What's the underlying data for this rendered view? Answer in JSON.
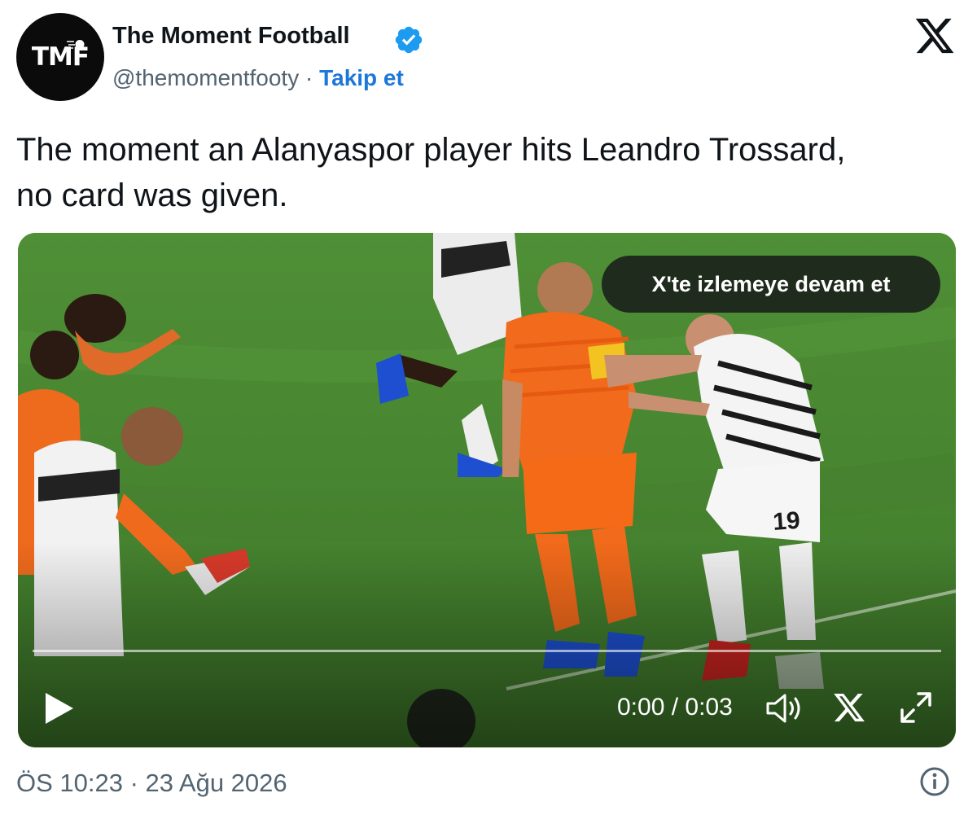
{
  "author": {
    "avatar_text": "TMF",
    "name": "The Moment Football",
    "handle": "@themomentfooty",
    "separator": " · ",
    "follow_label": "Takip et"
  },
  "tweet": {
    "text_line1": "The moment an Alanyaspor player hits Leandro Trossard,",
    "text_line2": "no card was given.",
    "timestamp": "ÖS 10:23 · 23 Ağu 2026"
  },
  "video": {
    "watch_on_x_label": "X'te izlemeye devam et",
    "time_display": "0:00 / 0:03",
    "progress": 0.0,
    "shirt_number": "19"
  },
  "colors": {
    "accent": "#1d77d8",
    "verified": "#1d9bf0",
    "text": "#0f1419",
    "muted": "#536471",
    "pitch": "#4c8a33",
    "orange_kit": "#f26a1b"
  },
  "icons": [
    "verified-badge-icon",
    "x-logo-icon",
    "play-icon",
    "volume-icon",
    "x-share-icon",
    "fullscreen-icon",
    "info-icon"
  ]
}
